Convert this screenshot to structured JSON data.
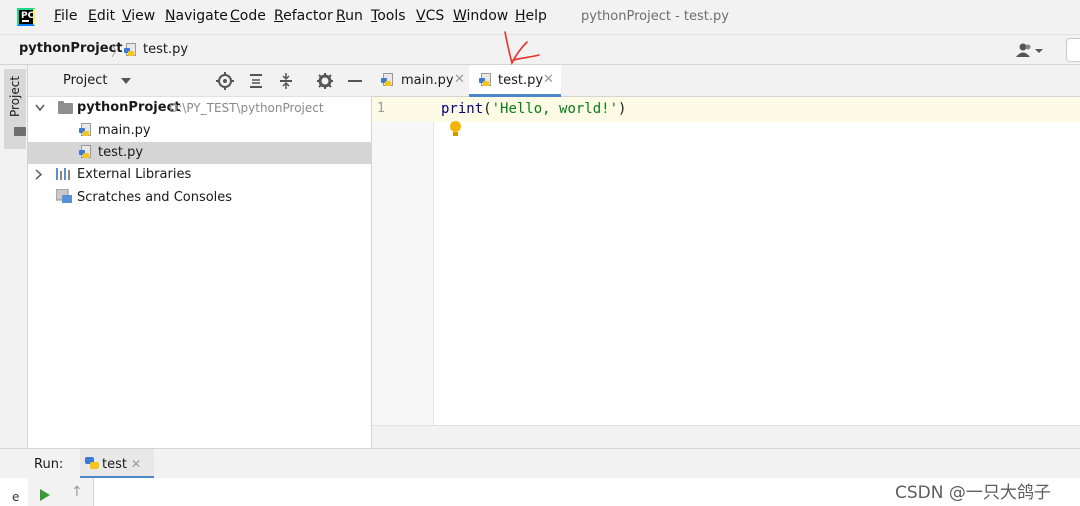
{
  "menubar": {
    "items": [
      "File",
      "Edit",
      "View",
      "Navigate",
      "Code",
      "Refactor",
      "Run",
      "Tools",
      "VCS",
      "Window",
      "Help"
    ],
    "window_title": "pythonProject - test.py"
  },
  "navbar": {
    "project": "pythonProject",
    "separator": "〉",
    "file": "test.py"
  },
  "sidebar": {
    "vertical_tab": "Project"
  },
  "project_panel": {
    "title": "Project",
    "tree": {
      "root_name": "pythonProject",
      "root_path": "D:\\PY_TEST\\pythonProject",
      "files": [
        "main.py",
        "test.py"
      ],
      "external_libraries": "External Libraries",
      "scratches": "Scratches and Consoles"
    }
  },
  "editor": {
    "tabs": [
      "main.py",
      "test.py"
    ],
    "active_tab": "test.py",
    "line_number": "1",
    "code": {
      "fn": "print",
      "open": "(",
      "str": "'Hello, world!'",
      "close": ")"
    }
  },
  "run": {
    "label": "Run:",
    "tab": "test"
  },
  "bottom_stripe": "e",
  "watermark": "CSDN @一只大鸽子",
  "colors": {
    "accent": "#4a88c7",
    "selection": "#d5d5d5",
    "caret_line": "#fdfbe6",
    "string": "#067d17",
    "annotation": "#e8332a"
  },
  "icons": [
    "pycharm-logo-icon",
    "python-file-icon",
    "folder-icon",
    "library-icon",
    "scratch-icon",
    "locate-icon",
    "expand-all-icon",
    "collapse-all-icon",
    "gear-icon",
    "minimize-icon",
    "lightbulb-icon",
    "run-icon",
    "up-arrow-icon",
    "user-icon"
  ]
}
